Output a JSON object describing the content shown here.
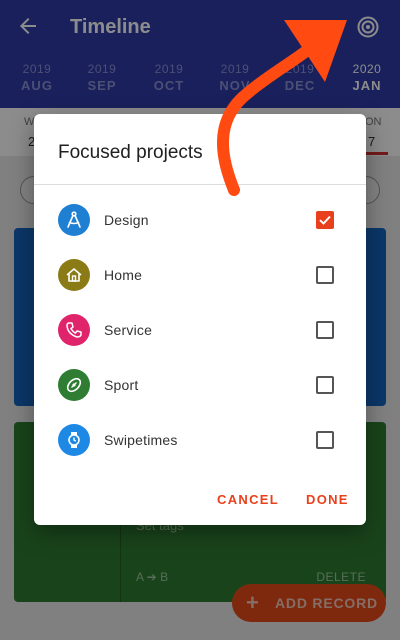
{
  "appbar": {
    "title": "Timeline",
    "back_icon": "arrow-left-icon",
    "target_icon": "target-icon",
    "background": "#2f3ba8"
  },
  "months": [
    {
      "year": "2019",
      "month": "AUG",
      "active": false
    },
    {
      "year": "2019",
      "month": "SEP",
      "active": false
    },
    {
      "year": "2019",
      "month": "OCT",
      "active": false
    },
    {
      "year": "2019",
      "month": "NOV",
      "active": false
    },
    {
      "year": "2019",
      "month": "DEC",
      "active": false
    },
    {
      "year": "2020",
      "month": "JAN",
      "active": true
    }
  ],
  "weekstrip": {
    "first_day": "W",
    "first_date": "2",
    "last_day": "ON",
    "last_date": "7"
  },
  "background_cards": {
    "green_card": {
      "tags_text": "Set tags",
      "ab_text": "A ➔ B",
      "delete_text": "DELETE",
      "color": "#2e7d32"
    },
    "blue_card_color": "#1565c0"
  },
  "fab": {
    "label": "ADD RECORD",
    "icon": "plus-icon",
    "color": "#e64a19"
  },
  "dialog": {
    "title": "Focused projects",
    "projects": [
      {
        "name": "Design",
        "icon": "compass-icon",
        "color": "#1e7fd3",
        "checked": true
      },
      {
        "name": "Home",
        "icon": "home-icon",
        "color": "#8a7b16",
        "checked": false
      },
      {
        "name": "Service",
        "icon": "phone-icon",
        "color": "#e0246b",
        "checked": false
      },
      {
        "name": "Sport",
        "icon": "football-icon",
        "color": "#2e7d32",
        "checked": false
      },
      {
        "name": "Swipetimes",
        "icon": "watch-icon",
        "color": "#1e88e5",
        "checked": false
      }
    ],
    "cancel_label": "CANCEL",
    "done_label": "DONE",
    "accent": "#e8401c"
  },
  "annotation": {
    "arrow_color": "#ff4a12"
  }
}
